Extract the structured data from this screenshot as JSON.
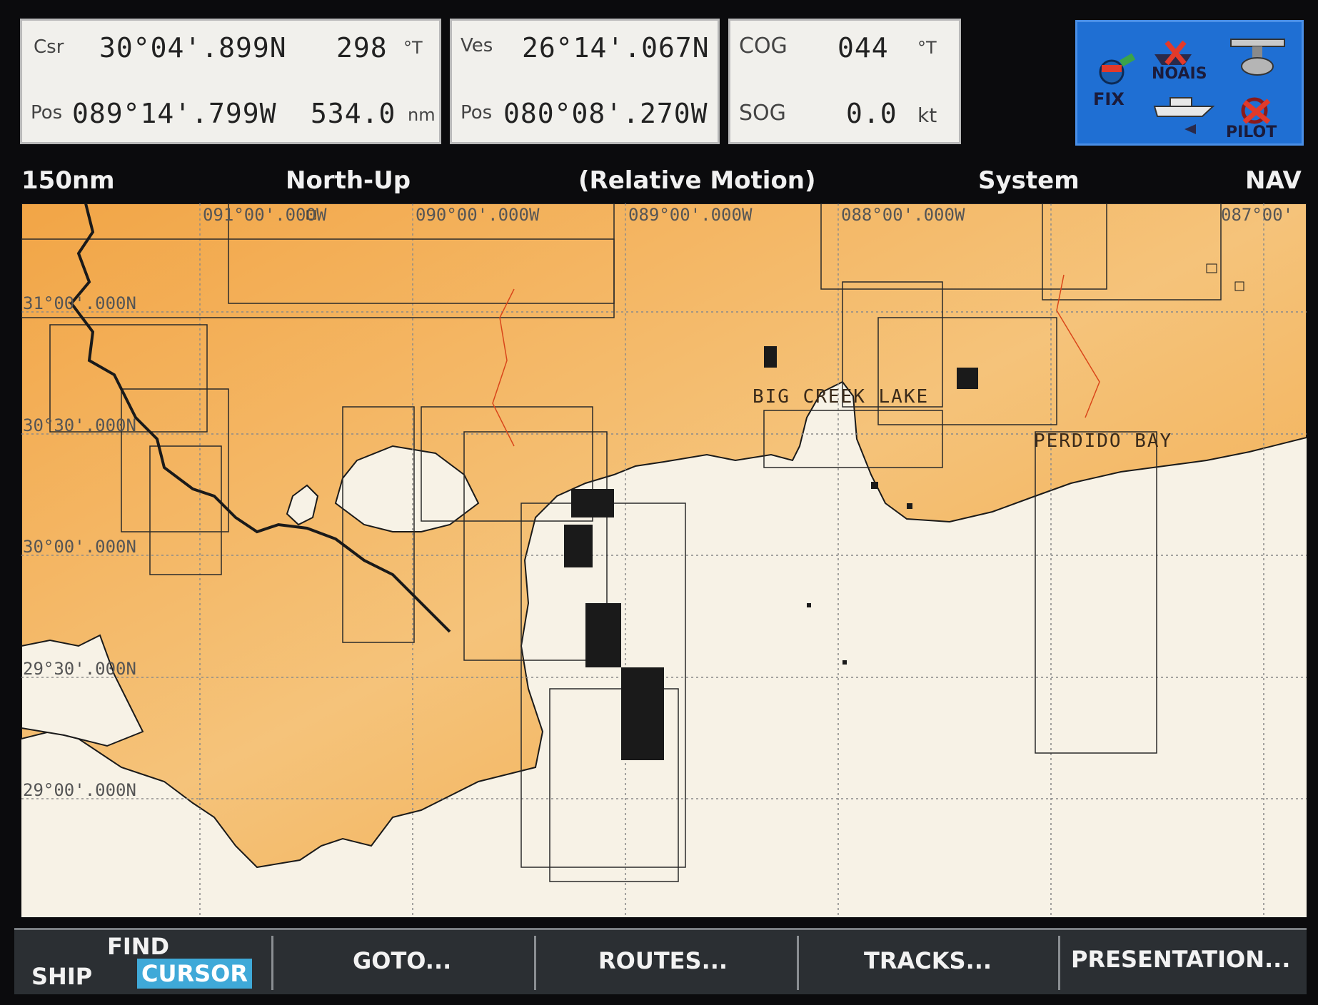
{
  "readouts": {
    "cursor": {
      "csr_label": "Csr",
      "pos_label": "Pos",
      "lat": "30°04'.899N",
      "lon": "089°14'.799W",
      "bearing": "298",
      "bearing_unit": "°T",
      "range": "534.0",
      "range_unit": "nm"
    },
    "vessel": {
      "ves_label": "Ves",
      "pos_label": "Pos",
      "lat": "26°14'.067N",
      "lon": "080°08'.270W"
    },
    "course": {
      "cog_label": "COG",
      "cog_value": "044",
      "cog_unit": "°T",
      "sog_label": "SOG",
      "sog_value": "0.0",
      "sog_unit": "kt"
    }
  },
  "status": {
    "fix_label": "FIX",
    "ais_label": "NOAIS",
    "pilot_label": "PILOT",
    "icons": [
      "gps-fix-icon",
      "ais-disabled-icon",
      "radar-antenna-icon",
      "boat-icon",
      "pilot-helm-icon"
    ]
  },
  "info_bar": {
    "range": "150nm",
    "orientation": "North-Up",
    "motion": "(Relative Motion)",
    "system": "System",
    "mode": "NAV"
  },
  "chart": {
    "lon_labels": [
      "091°00'.000W",
      "090°00'.000W",
      "089°00'.000W",
      "088°00'.000W",
      "087°00'"
    ],
    "lat_labels": [
      "31°00'.000N",
      "30°30'.000N",
      "30°00'.000N",
      "29°30'.000N",
      "29°00'.000N"
    ],
    "place_names": [
      "BIG CREEK LAKE",
      "PERDIDO BAY"
    ],
    "colors": {
      "land": "#f0b560",
      "water": "#f7f2e6",
      "grid": "#8a8a8a",
      "river": "#d9461a"
    }
  },
  "softkeys": {
    "ship": "SHIP",
    "find": "FIND",
    "cursor": "CURSOR",
    "goto": "GOTO...",
    "routes": "ROUTES...",
    "tracks": "TRACKS...",
    "presentation": "PRESENTATION..."
  }
}
